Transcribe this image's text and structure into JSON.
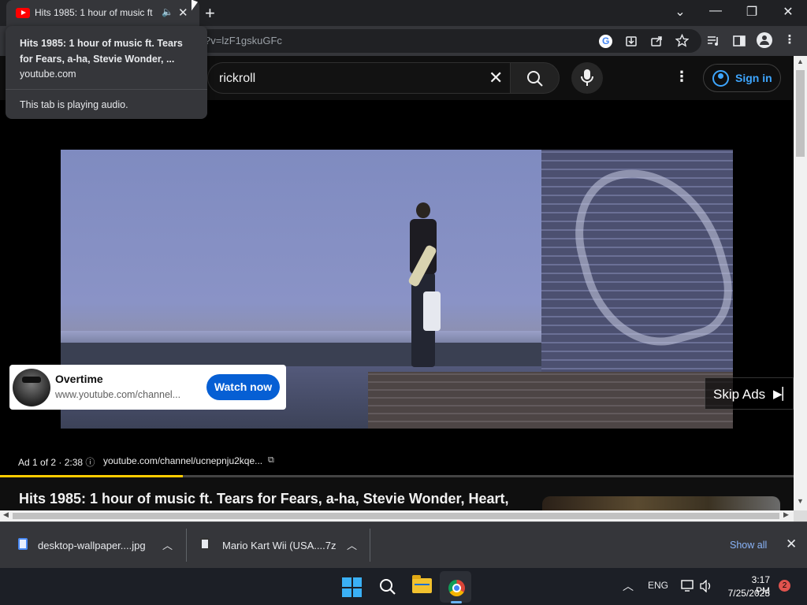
{
  "browser": {
    "tab": {
      "title": "Hits 1985: 1 hour of music ft",
      "speaker_glyph": "🔈",
      "close_glyph": "✕"
    },
    "new_tab_glyph": "+",
    "window_controls": {
      "dropdown": "⌄",
      "minimize": "—",
      "restore": "❐",
      "close": "✕"
    },
    "omnibox": {
      "url_fragment": "?v=lzF1gskuGFc"
    },
    "hover_card": {
      "title": "Hits 1985: 1 hour of music ft. Tears for Fears, a-ha, Stevie Wonder, ...",
      "domain": "youtube.com",
      "status": "This tab is playing audio."
    }
  },
  "youtube": {
    "search": {
      "query": "rickroll",
      "clear_glyph": "✕"
    },
    "more_glyph": "⋮",
    "signin_label": "Sign in",
    "ad_card": {
      "title": "Overtime",
      "subtitle": "www.youtube.com/channel...",
      "cta": "Watch now"
    },
    "skip": {
      "label": "Skip Ads",
      "glyph": "▶▏"
    },
    "ad_info": {
      "text": "Ad 1 of 2 · 2:38",
      "info_glyph": "ⓘ",
      "url": "youtube.com/channel/ucnepnju2kqe...",
      "external_glyph": "⧉"
    },
    "ad_progress": 0.23,
    "video_title": "Hits 1985: 1 hour of music ft. Tears for Fears, a-ha, Stevie Wonder, Heart,"
  },
  "downloads": {
    "items": [
      {
        "name": "desktop-wallpaper....jpg"
      },
      {
        "name": "Mario Kart Wii (USA....7z"
      }
    ],
    "show_all": "Show all",
    "close_glyph": "✕"
  },
  "taskbar": {
    "tray_chevron": "︿",
    "language": "ENG",
    "time": "3:17 PM",
    "date": "7/25/2023",
    "notifications": "2"
  },
  "colors": {
    "accent_blue": "#065fd4",
    "link_blue": "#3ea6ff",
    "ad_progress": "#ffcc00",
    "youtube_red": "#ff0000"
  }
}
